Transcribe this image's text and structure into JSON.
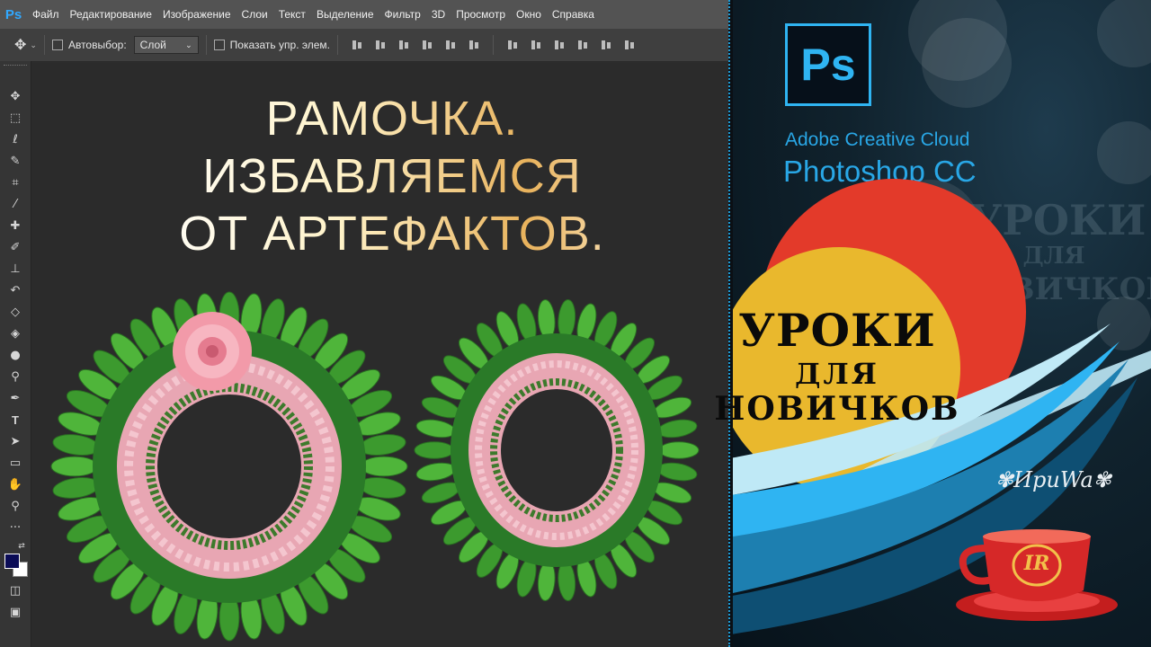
{
  "menubar": {
    "app_logo": "Ps",
    "items": [
      "Файл",
      "Редактирование",
      "Изображение",
      "Слои",
      "Текст",
      "Выделение",
      "Фильтр",
      "3D",
      "Просмотр",
      "Окно",
      "Справка"
    ]
  },
  "options_bar": {
    "move_tool_icon": "move-icon",
    "autoselect_label": "Автовыбор:",
    "autoselect_value": "Слой",
    "show_controls_label": "Показать упр. элем."
  },
  "toolbar": {
    "tools": [
      "move-icon",
      "marquee-icon",
      "lasso-icon",
      "quick-select-icon",
      "crop-icon",
      "eyedropper-icon",
      "healing-icon",
      "brush-icon",
      "stamp-icon",
      "history-brush-icon",
      "eraser-icon",
      "paint-bucket-icon",
      "blur-icon",
      "dodge-icon",
      "pen-icon",
      "type-icon",
      "path-select-icon",
      "rectangle-icon",
      "hand-icon",
      "zoom-icon",
      "more-icon"
    ],
    "foreground_color": "#0b0c56",
    "background_color": "#ffffff"
  },
  "canvas": {
    "title_lines": [
      "РАМОЧКА.",
      "ИЗБАВЛЯЕМСЯ",
      "ОТ АРТЕФАКТОВ."
    ]
  },
  "promo": {
    "badge": "Ps",
    "line1": "Adobe Creative Cloud",
    "line2": "Photoshop CC",
    "lesson_line1": "УРОКИ",
    "lesson_line2": "ДЛЯ",
    "lesson_line3": "НОВИЧКОВ",
    "watermark_lines": [
      "УРОКИ",
      "ДЛЯ",
      "НОВИЧКОВ"
    ],
    "signature": "✾ИриWa✾",
    "cup_monogram": "IR",
    "colors": {
      "accent_blue": "#2fb4f2",
      "red": "#e33a2a",
      "yellow": "#e9b82d"
    }
  }
}
